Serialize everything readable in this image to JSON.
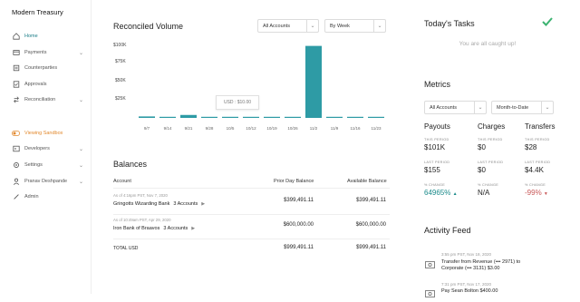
{
  "app": {
    "brand": "Modern Treasury"
  },
  "sidebar": {
    "items": [
      {
        "label": "Home"
      },
      {
        "label": "Payments"
      },
      {
        "label": "Counterparties"
      },
      {
        "label": "Approvals"
      },
      {
        "label": "Reconciliation"
      },
      {
        "label": "Viewing Sandbox"
      },
      {
        "label": "Developers"
      },
      {
        "label": "Settings"
      },
      {
        "label": "Pranav Deshpande"
      },
      {
        "label": "Admin"
      }
    ]
  },
  "reconciled": {
    "title": "Reconciled Volume",
    "account_select": "All Accounts",
    "period_select": "By Week",
    "tooltip": "USD : $10.00"
  },
  "chart_data": {
    "type": "bar",
    "categories": [
      "9/7",
      "9/14",
      "9/21",
      "9/28",
      "10/5",
      "10/12",
      "10/19",
      "10/26",
      "11/2",
      "11/9",
      "11/16",
      "11/23"
    ],
    "values": [
      2000,
      1000,
      4000,
      0,
      1500,
      500,
      0,
      500,
      98000,
      0,
      1000,
      500
    ],
    "y_ticks": [
      "$100K",
      "$75K",
      "$50K",
      "$25K"
    ],
    "ylim": [
      0,
      100000
    ],
    "color": "#2e9ba5"
  },
  "balances": {
    "title": "Balances",
    "headers": {
      "account": "Account",
      "prior": "Prior Day Balance",
      "available": "Available Balance"
    },
    "rows": [
      {
        "meta": "As of 4:16pm PST, Nov 7, 2020",
        "name": "Gringotts Wizarding Bank",
        "accounts": "3 Accounts",
        "prior": "$399,491.11",
        "available": "$399,491.11"
      },
      {
        "meta": "As of 10:49am PST, Apr 29, 2020",
        "name": "Iron Bank of Braavos",
        "accounts": "3 Accounts",
        "prior": "$600,000.00",
        "available": "$600,000.00"
      }
    ],
    "total": {
      "label": "TOTAL USD",
      "prior": "$999,491.11",
      "available": "$999,491.11"
    }
  },
  "tasks": {
    "title": "Today's Tasks",
    "empty": "You are all caught up!"
  },
  "metrics": {
    "title": "Metrics",
    "account_select": "All Accounts",
    "period_select": "Month-to-Date",
    "labels": {
      "this": "THIS PERIOD",
      "last": "LAST PERIOD",
      "change": "% CHANGE"
    },
    "columns": [
      {
        "name": "Payouts",
        "this": "$101K",
        "last": "$155",
        "change": "64965%"
      },
      {
        "name": "Charges",
        "this": "$0",
        "last": "$0",
        "change": "N/A"
      },
      {
        "name": "Transfers",
        "this": "$28",
        "last": "$4.4K",
        "change": "-99%"
      }
    ]
  },
  "activity": {
    "title": "Activity Feed",
    "items": [
      {
        "time": "3:55 pm PST, Nov 18, 2020",
        "text": "Transfer from Revenue (••• 2971) to Corporate (••• 3131) $3.00"
      },
      {
        "time": "7:31 pm PST, Nov 17, 2020",
        "text": "Pay Sean Bolton $400.00"
      }
    ]
  },
  "colors": {
    "accent": "#1a7d87",
    "sandbox": "#e2892e",
    "positive": "#1a8a8a",
    "negative": "#c95a5a",
    "check": "#3cb371"
  }
}
